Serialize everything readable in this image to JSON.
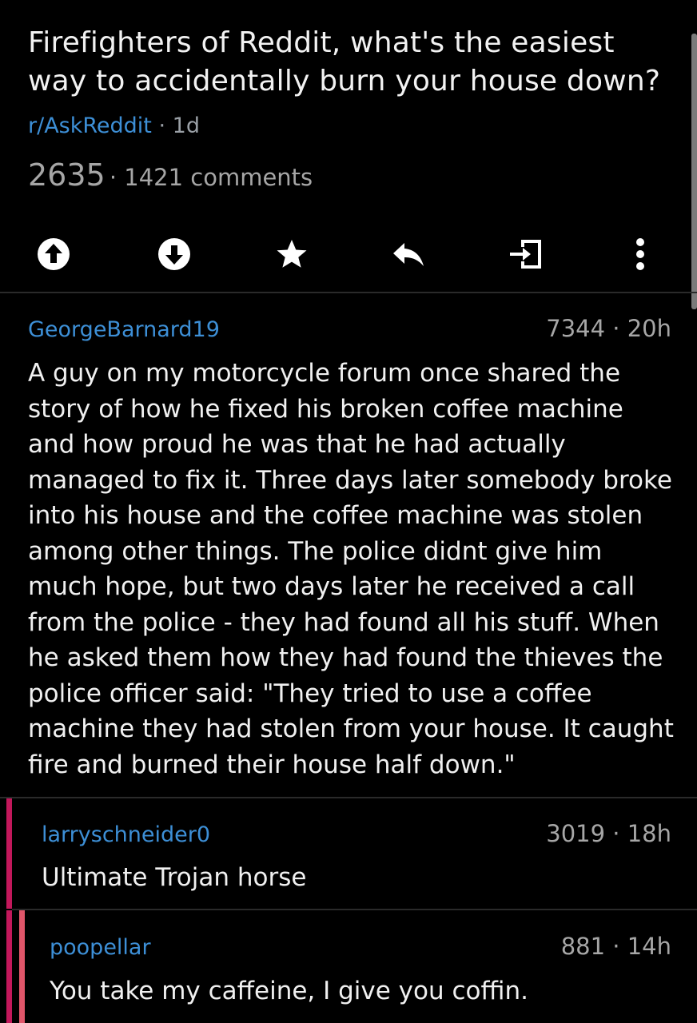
{
  "post": {
    "title": "Firefighters of Reddit, what's the easiest way to accidentally burn your house down?",
    "subreddit": "r/AskReddit",
    "age": "1d",
    "score": "2635",
    "comments": "1421 comments"
  },
  "actions": [
    {
      "icon": "upvote-icon"
    },
    {
      "icon": "downvote-icon"
    },
    {
      "icon": "star-icon"
    },
    {
      "icon": "reply-icon"
    },
    {
      "icon": "open-link-icon"
    },
    {
      "icon": "more-options-icon"
    }
  ],
  "comments": [
    {
      "author": "GeorgeBarnard19",
      "score": "7344",
      "age": "20h",
      "body": "A guy on my motorcycle forum once shared the story of how he fixed his broken coffee machine and how proud he was that he had actually managed to fix it. Three days later somebody broke into his house and the coffee machine was stolen among other things. The police didnt give him much hope, but two days later he received a call from the police - they had found all his stuff. When he asked them how they had found the thieves the police officer said: \"They tried to use a coffee machine they had stolen from your house. It caught fire and burned their house half down.\""
    },
    {
      "author": "larryschneider0",
      "score": "3019",
      "age": "18h",
      "body": "Ultimate Trojan horse",
      "rail_color": "#c2185b"
    },
    {
      "author": "poopellar",
      "score": "881",
      "age": "14h",
      "body": "You take my caffeine, I give you coffin.",
      "rail_color": "#e0566a"
    }
  ],
  "colors": {
    "background": "#000000",
    "link": "#3d8fd6",
    "muted": "#a6a6a6",
    "text": "#f0f0f0"
  }
}
